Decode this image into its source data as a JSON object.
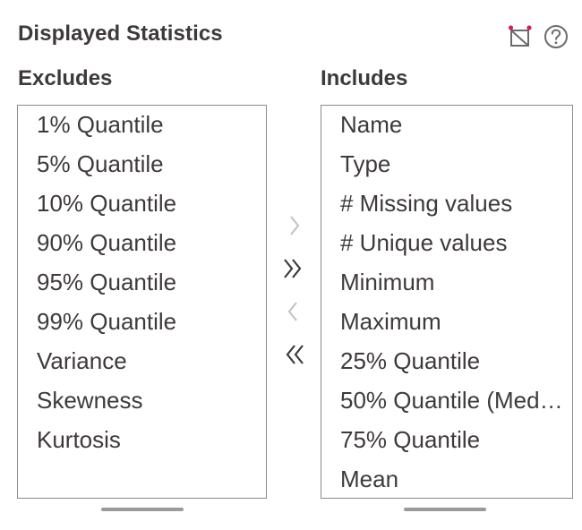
{
  "header": {
    "title": "Displayed Statistics",
    "reset_icon": "reset-filter-icon",
    "help_icon": "help-icon"
  },
  "excludes": {
    "label": "Excludes",
    "items": [
      "1% Quantile",
      "5% Quantile",
      "10% Quantile",
      "90% Quantile",
      "95% Quantile",
      "99% Quantile",
      "Variance",
      "Skewness",
      "Kurtosis"
    ]
  },
  "includes": {
    "label": "Includes",
    "items": [
      "Name",
      "Type",
      "# Missing values",
      "# Unique values",
      "Minimum",
      "Maximum",
      "25% Quantile",
      "50% Quantile (Median)",
      "75% Quantile",
      "Mean"
    ]
  },
  "controls": {
    "move_right_icon": "chevron-right-icon",
    "move_all_right_icon": "double-chevron-right-icon",
    "move_left_icon": "chevron-left-icon",
    "move_all_left_icon": "double-chevron-left-icon"
  },
  "colors": {
    "text": "#3e3a39",
    "border": "#8a8a8a",
    "accent": "#d0215c",
    "disabled_arrow": "#c5c5c5"
  }
}
